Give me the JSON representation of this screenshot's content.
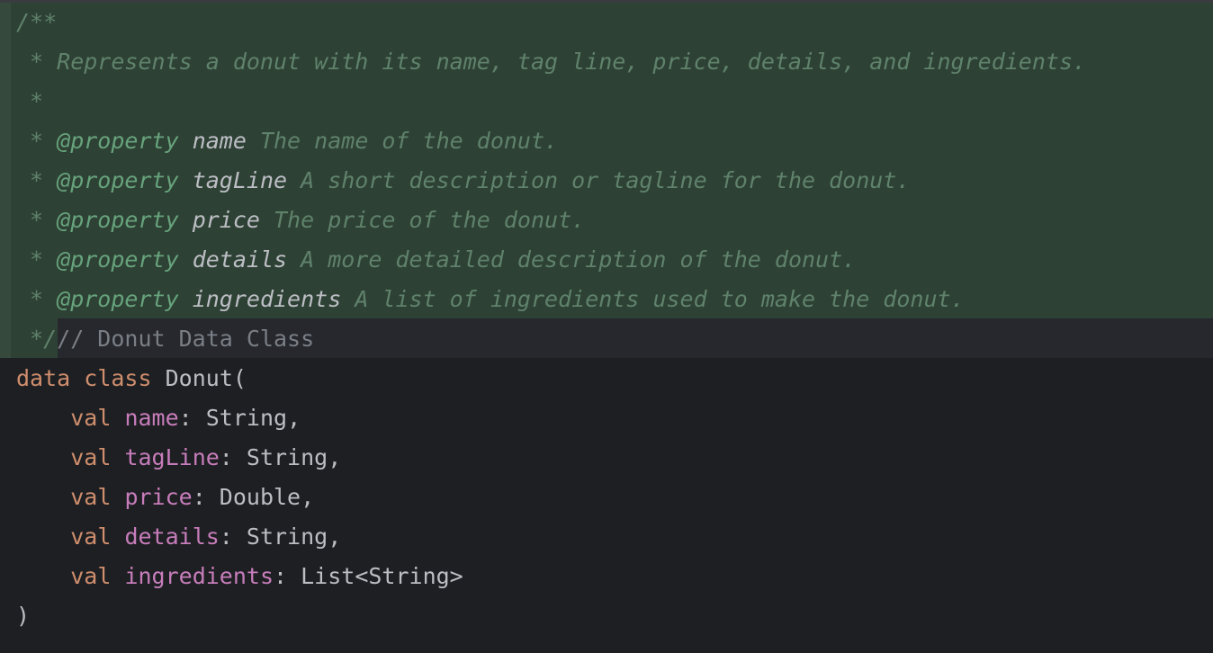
{
  "editor": {
    "language": "Kotlin",
    "colors": {
      "background": "#1e1f22",
      "diff_highlight": "#2e4135",
      "keyword": "#cf8e6d",
      "property": "#c77dbb",
      "doc_comment": "#5f826b",
      "doc_tag": "#67a37c",
      "line_comment": "#7a7e85",
      "text": "#bcbec4"
    },
    "lines": {
      "l1": {
        "doc": "/**"
      },
      "l2": {
        "doc": " * Represents a donut with its name, tag line, price, details, and ingredients."
      },
      "l3": {
        "doc": " *"
      },
      "l4": {
        "star": " * ",
        "tag": "@property",
        "sp": " ",
        "param": "name",
        "rest": " The name of the donut."
      },
      "l5": {
        "star": " * ",
        "tag": "@property",
        "sp": " ",
        "param": "tagLine",
        "rest": " A short description or tagline for the donut."
      },
      "l6": {
        "star": " * ",
        "tag": "@property",
        "sp": " ",
        "param": "price",
        "rest": " The price of the donut."
      },
      "l7": {
        "star": " * ",
        "tag": "@property",
        "sp": " ",
        "param": "details",
        "rest": " A more detailed description of the donut."
      },
      "l8": {
        "star": " * ",
        "tag": "@property",
        "sp": " ",
        "param": "ingredients",
        "rest": " A list of ingredients used to make the donut."
      },
      "l9": {
        "doc_end": " */",
        "comment": "// Donut Data Class"
      },
      "l10": {
        "kw1": "data",
        "kw2": "class",
        "name": "Donut",
        "open": "("
      },
      "l11": {
        "kw": "val",
        "prop": "name",
        "type": ": String,"
      },
      "l12": {
        "kw": "val",
        "prop": "tagLine",
        "type": ": String,"
      },
      "l13": {
        "kw": "val",
        "prop": "price",
        "type": ": Double,"
      },
      "l14": {
        "kw": "val",
        "prop": "details",
        "type": ": String,"
      },
      "l15": {
        "kw": "val",
        "prop": "ingredients",
        "type": ": List<String>"
      },
      "l16": {
        "close": ")"
      }
    }
  }
}
